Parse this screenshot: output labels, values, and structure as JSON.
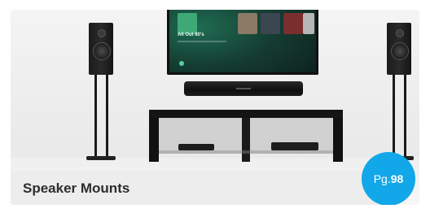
{
  "card": {
    "caption": "Speaker Mounts",
    "badge_prefix": "Pg.",
    "badge_number": "98"
  },
  "tv_screen": {
    "title": "All Out 80's"
  },
  "colors": {
    "badge": "#12a7e8",
    "caption_text": "#2d2d2d",
    "caption_bg": "#ececec"
  },
  "icons": [
    "speaker-icon",
    "soundbar-icon",
    "tv-icon"
  ]
}
